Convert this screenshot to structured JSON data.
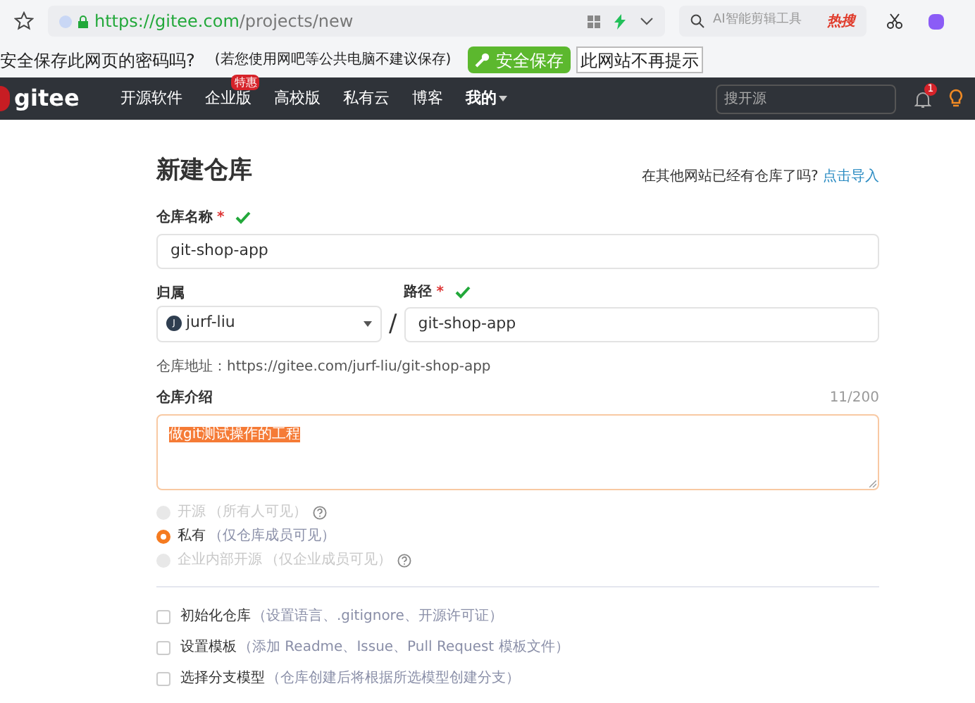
{
  "browser": {
    "url_host": "https://gitee.com",
    "url_path": "/projects/new",
    "search_placeholder": "AI智能剪辑工具",
    "hot_label": "热搜"
  },
  "password_bar": {
    "prompt": "安全保存此网页的密码吗?",
    "note": "(若您使用网吧等公共电脑不建议保存)",
    "save_button": "安全保存",
    "never_button": "此网站不再提示"
  },
  "nav": {
    "logo": "gitee",
    "items": [
      {
        "label": "开源软件"
      },
      {
        "label": "企业版",
        "badge": "特惠"
      },
      {
        "label": "高校版"
      },
      {
        "label": "私有云"
      },
      {
        "label": "博客"
      }
    ],
    "menu": "我的",
    "search_placeholder": "搜开源",
    "notification_count": "1"
  },
  "form": {
    "title": "新建仓库",
    "import_prompt": "在其他网站已经有仓库了吗?",
    "import_link": "点击导入",
    "name_label": "仓库名称",
    "name_required": "*",
    "name_value": "git-shop-app",
    "owner_label": "归属",
    "owner_avatar": "J",
    "owner_value": "jurf-liu",
    "separator": "/",
    "path_label": "路径",
    "path_required": "*",
    "path_value": "git-shop-app",
    "address": "仓库地址：https://gitee.com/jurf-liu/git-shop-app",
    "intro_label": "仓库介绍",
    "intro_count": "11/200",
    "intro_value": "做git测试操作的工程",
    "visibility": [
      {
        "label": "开源",
        "note": "（所有人可见）",
        "selected": false,
        "disabled": true,
        "help": true
      },
      {
        "label": "私有",
        "note": "（仅仓库成员可见）",
        "selected": true,
        "disabled": false,
        "help": false
      },
      {
        "label": "企业内部开源",
        "note": "（仅企业成员可见）",
        "selected": false,
        "disabled": true,
        "help": true
      }
    ],
    "options": [
      {
        "label": "初始化仓库",
        "note": "（设置语言、.gitignore、开源许可证）",
        "checked": false
      },
      {
        "label": "设置模板",
        "note": "（添加 Readme、Issue、Pull Request 模板文件）",
        "checked": false
      },
      {
        "label": "选择分支模型",
        "note": "（仓库创建后将根据所选模型创建分支）",
        "checked": false
      }
    ]
  }
}
